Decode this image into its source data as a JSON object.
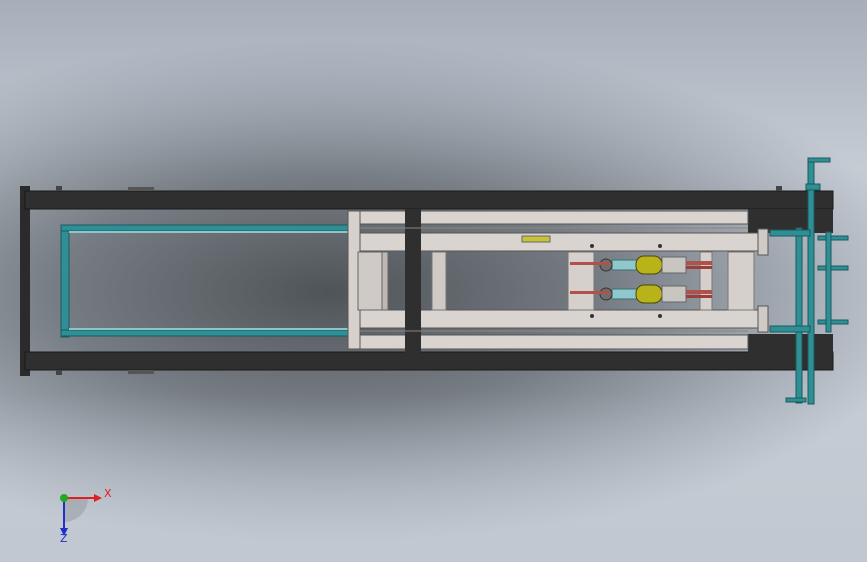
{
  "triad": {
    "x_label": "X",
    "z_label": "Z"
  },
  "colors": {
    "frame_dark": "#2b2b2b",
    "rail_teal": "#2e8f94",
    "beam_light": "#d9d4cf",
    "cylinder_yellow": "#b8b318",
    "rod_red": "#b0524c",
    "axis_x": "#e02020",
    "axis_y": "#22aa22",
    "axis_z": "#2030c8"
  }
}
